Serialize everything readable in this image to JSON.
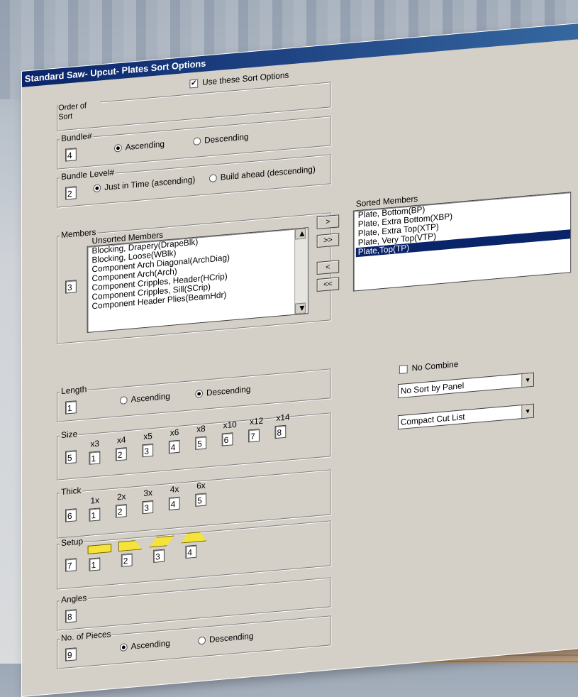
{
  "window": {
    "title": "Standard Saw- Upcut- Plates Sort Options"
  },
  "use_options": {
    "label": "Use these Sort Options",
    "checked": true
  },
  "order": {
    "label": "Order of Sort"
  },
  "bundle": {
    "label": "Bundle#",
    "value": "4",
    "asc": "Ascending",
    "desc": "Descending",
    "selected": "Ascending"
  },
  "bundle_level": {
    "label": "Bundle Level#",
    "value": "2",
    "opt1": "Just in Time (ascending)",
    "opt2": "Build ahead (descending)",
    "selected": "opt1"
  },
  "members": {
    "label": "Members",
    "value": "3",
    "unsorted_label": "Unsorted Members",
    "unsorted": [
      "Blocking, Drapery(DrapeBlk)",
      "Blocking, Loose(WBlk)",
      "Component Arch Diagonal(ArchDiag)",
      "Component Arch(Arch)",
      "Component Cripples, Header(HCrip)",
      "Component Cripples, Sill(SCrip)",
      "Component Header Plies(BeamHdr)"
    ],
    "sorted_label": "Sorted Members",
    "sorted": [
      "Plate, Bottom(BP)",
      "Plate, Extra Bottom(XBP)",
      "Plate, Extra Top(XTP)",
      "Plate, Very Top(VTP)",
      "Plate,Top(TP)"
    ],
    "selected_index": 4,
    "buttons": [
      ">",
      ">>",
      "<",
      "<<"
    ]
  },
  "length": {
    "label": "Length",
    "value": "1",
    "asc": "Ascending",
    "desc": "Descending",
    "selected": "Descending"
  },
  "size": {
    "label": "Size",
    "value": "5",
    "cols": [
      {
        "h": "x3",
        "v": "1"
      },
      {
        "h": "x4",
        "v": "2"
      },
      {
        "h": "x5",
        "v": "3"
      },
      {
        "h": "x6",
        "v": "4"
      },
      {
        "h": "x8",
        "v": "5"
      },
      {
        "h": "x10",
        "v": "6"
      },
      {
        "h": "x12",
        "v": "7"
      },
      {
        "h": "x14",
        "v": "8"
      }
    ]
  },
  "thick": {
    "label": "Thick",
    "value": "6",
    "cols": [
      {
        "h": "1x",
        "v": "1"
      },
      {
        "h": "2x",
        "v": "2"
      },
      {
        "h": "3x",
        "v": "3"
      },
      {
        "h": "4x",
        "v": "4"
      },
      {
        "h": "6x",
        "v": "5"
      }
    ]
  },
  "setup": {
    "label": "Setup",
    "value": "7",
    "cols": [
      "1",
      "2",
      "3",
      "4"
    ],
    "shape_color": "#f5e33a"
  },
  "angles": {
    "label": "Angles",
    "value": "8"
  },
  "pieces": {
    "label": "No. of Pieces",
    "value": "9",
    "asc": "Ascending",
    "desc": "Descending",
    "selected": "Ascending"
  },
  "no_combine": {
    "label": "No Combine",
    "checked": false
  },
  "panel_sort": {
    "value": "No Sort by Panel"
  },
  "cut_list": {
    "value": "Compact Cut List"
  }
}
